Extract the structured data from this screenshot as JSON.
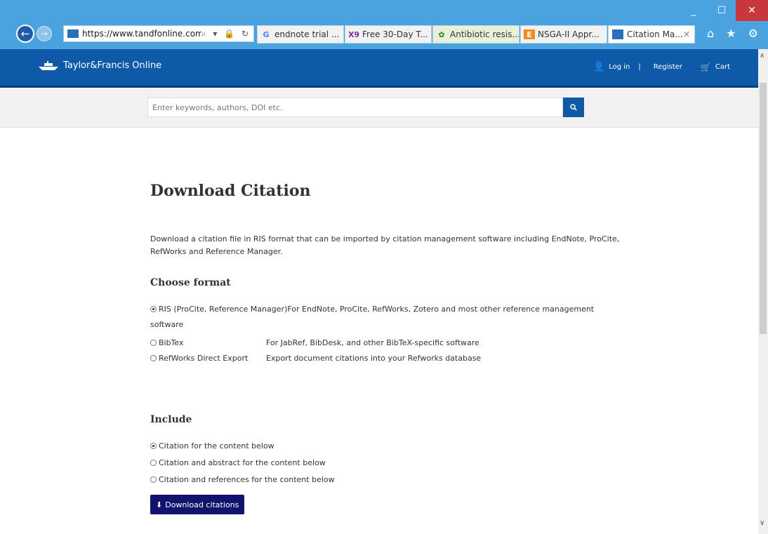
{
  "browser": {
    "address": "https://www.tandfonline.com/",
    "address_tools": "⌕ ▾ 🔒 ↻",
    "tabs": [
      {
        "label": "endnote trial ...",
        "icon_text": "G",
        "icon": "google-icon",
        "color": "#4285f4"
      },
      {
        "label": "Free 30-Day T...",
        "icon_text": "X9",
        "icon": "x9-icon",
        "color": "#7a2fa3"
      },
      {
        "label": "Antibiotic resis...",
        "icon_text": "✿",
        "icon": "site-icon",
        "color": "#2a7a3a"
      },
      {
        "label": "NSGA-II Appr...",
        "icon_text": "E",
        "icon": "elsevier-icon",
        "color": "#f08c1c"
      },
      {
        "label": "Citation Ma...",
        "icon_text": "",
        "icon": "tandf-icon",
        "color": "#2b6fb8",
        "active": true
      }
    ],
    "window_controls": {
      "minimize": "_",
      "maximize": "☐",
      "close": "✕"
    },
    "toolbar_icons": "⌂ ★ ⚙"
  },
  "header": {
    "brand": "Taylor&Francis Online",
    "login": "Log in",
    "separator": "|",
    "register": "Register",
    "cart": "Cart",
    "accent_color": "#0f5aa8"
  },
  "search": {
    "placeholder": "Enter keywords, authors, DOI etc."
  },
  "main": {
    "title": "Download Citation",
    "intro": "Download a citation file in RIS format that can be imported by citation management software including EndNote, ProCite, RefWorks and Reference Manager.",
    "format_heading": "Choose format",
    "formats": [
      {
        "label": "RIS (ProCite, Reference Manager)",
        "description": "For EndNote, ProCite, RefWorks, Zotero and most other reference management software",
        "selected": true
      },
      {
        "label": "BibTex",
        "description": "For JabRef, BibDesk, and other BibTeX-specific software",
        "selected": false
      },
      {
        "label": "RefWorks Direct Export",
        "description": "Export document citations into your Refworks database",
        "selected": false
      }
    ],
    "include_heading": "Include",
    "include_options": [
      {
        "label": "Citation for the content below",
        "selected": true
      },
      {
        "label": "Citation and abstract for the content below",
        "selected": false
      },
      {
        "label": "Citation and references for the content below",
        "selected": false
      }
    ],
    "download_label": "Download citations",
    "button_color": "#10146e"
  }
}
